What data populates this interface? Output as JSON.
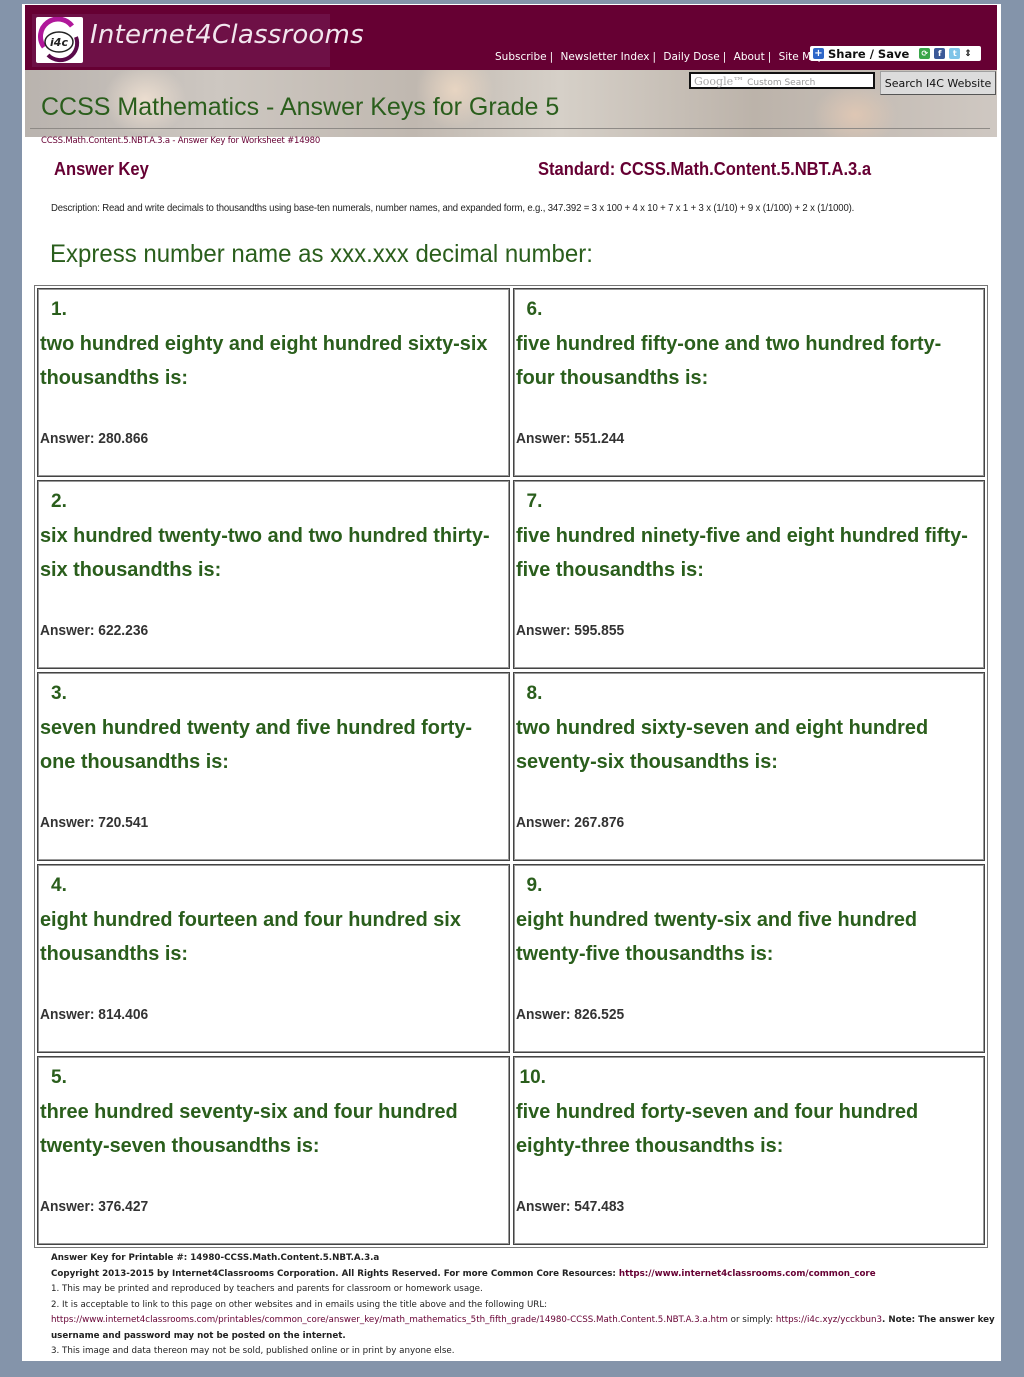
{
  "site": {
    "logo_badge": "i4c",
    "name": "Internet4Classrooms",
    "nav": [
      "Subscribe",
      "Newsletter Index",
      "Daily Dose",
      "About",
      "Site Map"
    ],
    "share_label": "Share / Save",
    "search": {
      "placeholder_brand": "Google™",
      "placeholder": "Custom Search",
      "value": "",
      "button_label": "Search I4C Website"
    },
    "colors": {
      "brand_maroon": "#660033",
      "title_green": "#2a5e1c",
      "page_bg": "#8494aa"
    }
  },
  "banner": {
    "title": "CCSS Mathematics - Answer Keys for Grade 5"
  },
  "breadcrumb": "CCSS.Math.Content.5.NBT.A.3.a - Answer Key for Worksheet #14980",
  "header": {
    "answer_key_label": "Answer Key",
    "standard_label": "Standard: CCSS.Math.Content.5.NBT.A.3.a"
  },
  "description": "Description: Read and write decimals to thousandths using base-ten numerals, number names, and expanded form, e.g., 347.392 = 3 x 100 + 4 x 10 + 7 x 1 + 3 x (1/10) + 9 x (1/100) + 2 x (1/1000).",
  "instructions": "Express number name as xxx.xxx decimal number:",
  "problems": [
    {
      "number": "1.",
      "text": "two hundred eighty and eight hundred sixty-six thousandths is:",
      "answer": "Answer: 280.866"
    },
    {
      "number": "6.",
      "text": "five hundred fifty-one and two hundred forty-four thousandths is:",
      "answer": "Answer: 551.244"
    },
    {
      "number": "2.",
      "text": "six hundred twenty-two and two hundred thirty-six thousandths is:",
      "answer": "Answer: 622.236"
    },
    {
      "number": "7.",
      "text": "five hundred ninety-five and eight hundred fifty-five thousandths is:",
      "answer": "Answer: 595.855"
    },
    {
      "number": "3.",
      "text": "seven hundred twenty and five hundred forty-one thousandths is:",
      "answer": "Answer: 720.541"
    },
    {
      "number": "8.",
      "text": "two hundred sixty-seven and eight hundred seventy-six thousandths is:",
      "answer": "Answer: 267.876"
    },
    {
      "number": "4.",
      "text": "eight hundred fourteen and four hundred six thousandths is:",
      "answer": "Answer: 814.406"
    },
    {
      "number": "9.",
      "text": "eight hundred twenty-six and five hundred twenty-five thousandths is:",
      "answer": "Answer: 826.525"
    },
    {
      "number": "5.",
      "text": "three hundred seventy-six and four hundred twenty-seven thousandths is:",
      "answer": "Answer: 376.427"
    },
    {
      "number": "10.",
      "text": "five hundred forty-seven and four hundred eighty-three thousandths is:",
      "answer": "Answer: 547.483"
    }
  ],
  "footer": {
    "printable_line": "Answer Key for Printable #: 14980-CCSS.Math.Content.5.NBT.A.3.a",
    "copyright": "Copyright 2013-2015 by Internet4Classrooms Corporation. All Rights Reserved. For more Common Core Resources: ",
    "copyright_link": "https://www.internet4classrooms.com/common_core",
    "note1": "1. This may be printed and reproduced by teachers and parents for classroom or homework usage.",
    "note2": "2. It is acceptable to link to this page on other websites and in emails using the title above and the following URL:",
    "url_full": "https://www.internet4classrooms.com/printables/common_core/answer_key/math_mathematics_5th_fifth_grade/14980-CCSS.Math.Content.5.NBT.A.3.a.htm",
    "or_simply": " or simply: ",
    "url_short": "https://i4c.xyz/ycckbun3",
    "note_suffix": ". Note: The answer key username and password may not be posted on the internet.",
    "note3": "3. This image and data thereon may not be sold, published online or in print by anyone else."
  }
}
